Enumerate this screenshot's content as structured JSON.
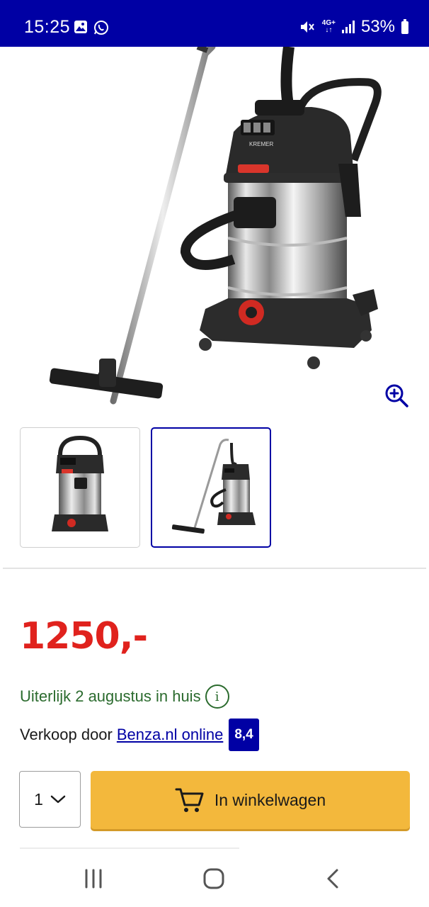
{
  "status_bar": {
    "time": "15:25",
    "left_icons": [
      "gallery-icon",
      "whatsapp-icon"
    ],
    "right_icons": [
      "mute-icon",
      "network-4g-icon",
      "signal-icon",
      "battery-icon"
    ],
    "network_label_top": "4G+",
    "network_label_bottom": "↓↑",
    "battery": "53%",
    "background": "#0000a4"
  },
  "product": {
    "main_image": "vacuum-cleaner-with-hose-and-floor-nozzle",
    "brand_text": "KREMER",
    "thumbnails": [
      {
        "image": "vacuum-cleaner-front-view",
        "active": false
      },
      {
        "image": "vacuum-cleaner-with-hose",
        "active": true
      }
    ],
    "price": "1250,-",
    "price_color": "#e0221d",
    "delivery_text": "Uiterlijk 2 augustus in huis",
    "delivery_color": "#2b6b2e",
    "seller_prefix": "Verkoop door",
    "seller_name": "Benza.nl online",
    "seller_rating": "8,4",
    "quantity": "1",
    "cart_button_label": "In winkelwagen",
    "cart_button_color": "#f3b83c",
    "accent": "#0000a4"
  },
  "nav_bar": {
    "buttons": [
      "recent-apps-icon",
      "home-icon",
      "back-icon"
    ]
  }
}
